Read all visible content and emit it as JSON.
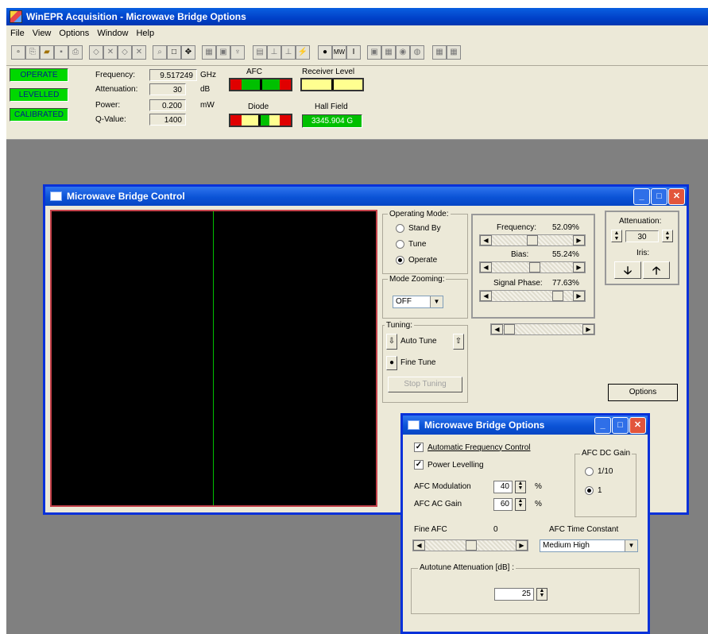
{
  "window_title": "WinEPR Acquisition - Microwave Bridge Options",
  "menu": [
    "File",
    "View",
    "Options",
    "Window",
    "Help"
  ],
  "status_panel": {
    "leds": [
      "OPERATE",
      "LEVELLED",
      "CALIBRATED"
    ],
    "frequency_label": "Frequency:",
    "frequency_value": "9.517249",
    "frequency_unit": "GHz",
    "attenuation_label": "Attenuation:",
    "attenuation_value": "30",
    "attenuation_unit": "dB",
    "power_label": "Power:",
    "power_value": "0.200",
    "power_unit": "mW",
    "qvalue_label": "Q-Value:",
    "qvalue_value": "1400",
    "afc_label": "AFC",
    "receiver_label": "Receiver Level",
    "diode_label": "Diode",
    "hall_label": "Hall Field",
    "hall_value": "3345.904 G"
  },
  "bridge_control": {
    "title": "Microwave Bridge Control",
    "operating_mode": {
      "label": "Operating Mode:",
      "options": [
        "Stand By",
        "Tune",
        "Operate"
      ],
      "selected": "Operate"
    },
    "mode_zooming": {
      "label": "Mode Zooming:",
      "value": "OFF"
    },
    "tuning": {
      "label": "Tuning:",
      "auto_tune": "Auto Tune",
      "fine_tune": "Fine Tune",
      "stop_tuning": "Stop Tuning"
    },
    "frequency_label": "Frequency:",
    "frequency_pct": "52.09%",
    "bias_label": "Bias:",
    "bias_pct": "55.24%",
    "phase_label": "Signal Phase:",
    "phase_pct": "77.63%",
    "attenuation_label": "Attenuation:",
    "attenuation_value": "30",
    "iris_label": "Iris:",
    "options_button": "Options"
  },
  "bridge_options": {
    "title": "Microwave Bridge Options",
    "afc_checkbox": "Automatic Frequency Control",
    "power_levelling_checkbox": "Power Levelling",
    "afc_modulation_label": "AFC Modulation",
    "afc_modulation_value": "40",
    "afc_modulation_unit": "%",
    "afc_ac_gain_label": "AFC AC Gain",
    "afc_ac_gain_value": "60",
    "afc_ac_gain_unit": "%",
    "afc_dc_gain_label": "AFC DC Gain",
    "afc_dc_gain_options": [
      "1/10",
      "1"
    ],
    "afc_dc_gain_selected": "1",
    "fine_afc_label": "Fine AFC",
    "fine_afc_value": "0",
    "afc_time_constant_label": "AFC Time Constant",
    "afc_time_constant_value": "Medium High",
    "autotune_label": "Autotune Attenuation [dB] :",
    "autotune_value": "25"
  },
  "colors": {
    "led_green": "#00d800",
    "title_blue": "#0b53d6",
    "scope_trace": "#00c000",
    "scope_border": "#c4424a"
  }
}
